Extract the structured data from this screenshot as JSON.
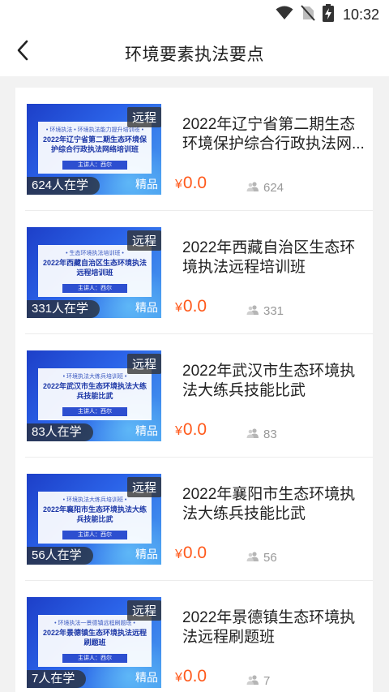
{
  "status_bar": {
    "time": "10:32",
    "icons": [
      "wifi-icon",
      "no-sim-icon",
      "battery-charging-icon"
    ]
  },
  "header": {
    "back_icon": "chevron-left-icon",
    "title": "环境要素执法要点"
  },
  "courses": [
    {
      "title": "2022年辽宁省第二期生态环境保护综合行政执法网...",
      "poster_subtitle": "• 环境执法 • 环境执法能力提升培训班 •",
      "poster_title": "2022年辽宁省第二期生态环境保护综合行政执法网络培训班",
      "poster_lecturer": "主讲人：西尔",
      "tag": "远程",
      "learners": "624人在学",
      "badge": "精品",
      "currency": "¥",
      "price": "0.0",
      "students": "624"
    },
    {
      "title": "2022年西藏自治区生态环境执法远程培训班",
      "poster_subtitle": "• 生态环境执法培训班 •",
      "poster_title": "2022年西藏自治区生态环境执法远程培训班",
      "poster_lecturer": "主讲人：西尔",
      "tag": "远程",
      "learners": "331人在学",
      "badge": "精品",
      "currency": "¥",
      "price": "0.0",
      "students": "331"
    },
    {
      "title": "2022年武汉市生态环境执法大练兵技能比武",
      "poster_subtitle": "• 环境执法大练兵培训班 •",
      "poster_title": "2022年武汉市生态环境执法大练兵技能比武",
      "poster_lecturer": "主讲人：西尔",
      "tag": "远程",
      "learners": "83人在学",
      "badge": "精品",
      "currency": "¥",
      "price": "0.0",
      "students": "83"
    },
    {
      "title": "2022年襄阳市生态环境执法大练兵技能比武",
      "poster_subtitle": "• 环境执法大练兵培训班 •",
      "poster_title": "2022年襄阳市生态环境执法大练兵技能比武",
      "poster_lecturer": "主讲人：西尔",
      "tag": "远程",
      "learners": "56人在学",
      "badge": "精品",
      "currency": "¥",
      "price": "0.0",
      "students": "56"
    },
    {
      "title": "2022年景德镇生态环境执法远程刷题班",
      "poster_subtitle": "• 环境执法一景德镇远程刷题班 •",
      "poster_title": "2022年景德镇生态环境执法远程刷题班",
      "poster_lecturer": "主讲人：西尔",
      "tag": "远程",
      "learners": "7人在学",
      "badge": "精品",
      "currency": "¥",
      "price": "0.0",
      "students": "7"
    }
  ],
  "colors": {
    "price": "#ff5a1c",
    "text": "#222222",
    "muted": "#999999",
    "poster_blue": "#2b63e8"
  }
}
